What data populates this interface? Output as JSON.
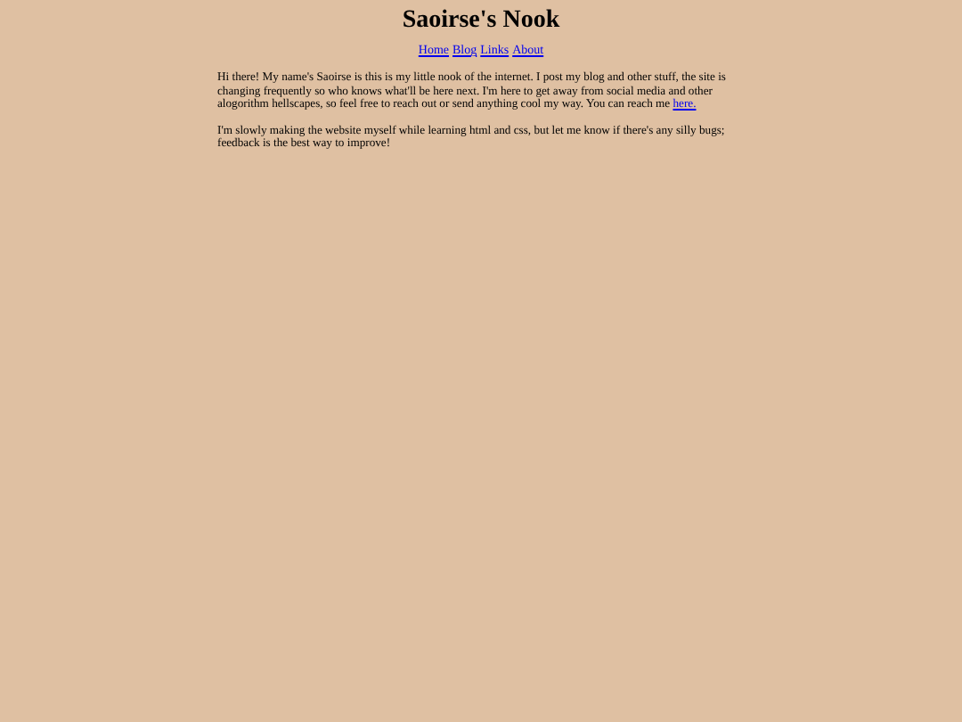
{
  "header": {
    "title": "Saoirse's Nook"
  },
  "nav": [
    {
      "label": "Home"
    },
    {
      "label": "Blog"
    },
    {
      "label": "Links"
    },
    {
      "label": "About"
    }
  ],
  "paragraphs": [
    {
      "text": "Hi there! My name's Saoirse is this is my little nook of the internet. I post my blog and other stuff, the site is changing frequently so who knows what'll be here next. I'm here to get away from social media and other alogorithm hellscapes, so feel free to reach out or send anything cool my way. You can reach me ",
      "link": "here."
    },
    {
      "text": "I'm slowly making the website myself while learning html and css, but let me know if there's any silly bugs; feedback is the best way to improve!"
    }
  ]
}
